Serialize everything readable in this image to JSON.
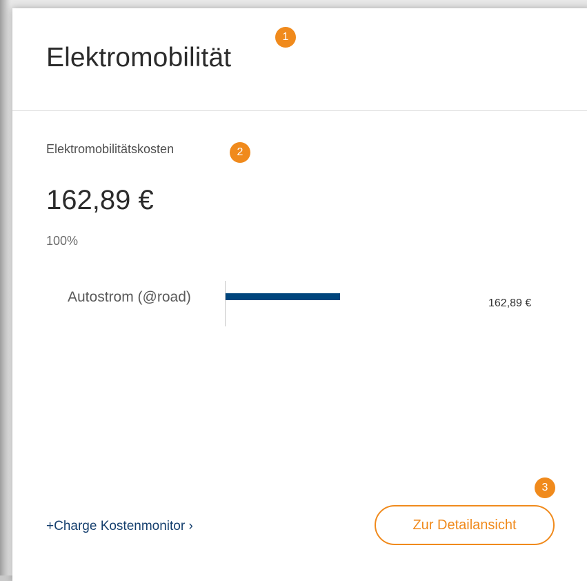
{
  "card": {
    "title": "Elektromobilität",
    "subtitle": "Elektromobilitätskosten",
    "total_amount": "162,89 €",
    "share": "100%"
  },
  "badges": [
    "1",
    "2",
    "3"
  ],
  "chart_data": {
    "type": "bar",
    "orientation": "horizontal",
    "categories": [
      "Autostrom (@road)"
    ],
    "values": [
      162.89
    ],
    "value_labels": [
      "162,89 €"
    ],
    "colors": [
      "#00457c"
    ]
  },
  "footer": {
    "link_label": "+Charge Kostenmonitor ›",
    "button_label": "Zur Detailansicht"
  },
  "colors": {
    "accent": "#f08a1c",
    "bar": "#00457c",
    "link": "#153f6e"
  }
}
